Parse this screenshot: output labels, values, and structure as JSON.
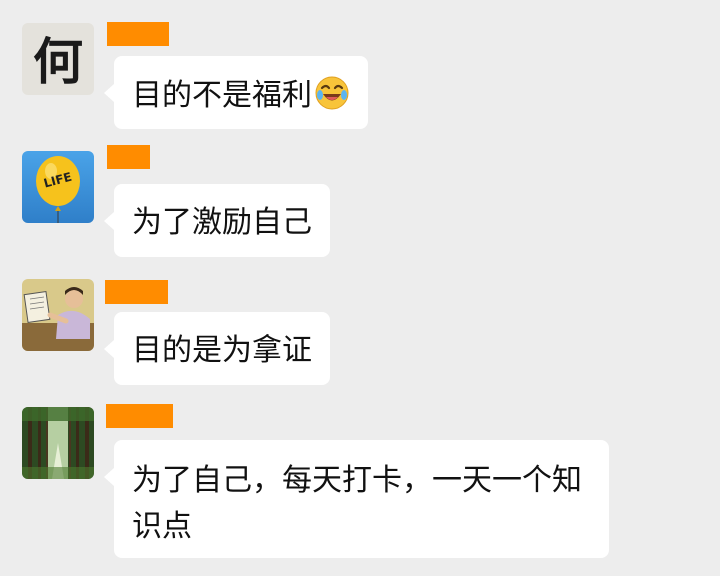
{
  "colors": {
    "background": "#ededed",
    "bubble": "#ffffff",
    "name_redaction": "#ff8c00",
    "text": "#111111"
  },
  "messages": [
    {
      "avatar": {
        "icon": "calligraphy-character-avatar",
        "glyph": "何"
      },
      "text": "目的不是福利",
      "trailing_emoji": "rofl-emoji"
    },
    {
      "avatar": {
        "icon": "life-balloon-avatar",
        "label": "LIFE"
      },
      "text": "为了激励自己"
    },
    {
      "avatar": {
        "icon": "reading-man-avatar"
      },
      "text": "目的是为拿证"
    },
    {
      "avatar": {
        "icon": "forest-path-avatar"
      },
      "text": "为了自己，每天打卡，一天一个知识点"
    }
  ]
}
